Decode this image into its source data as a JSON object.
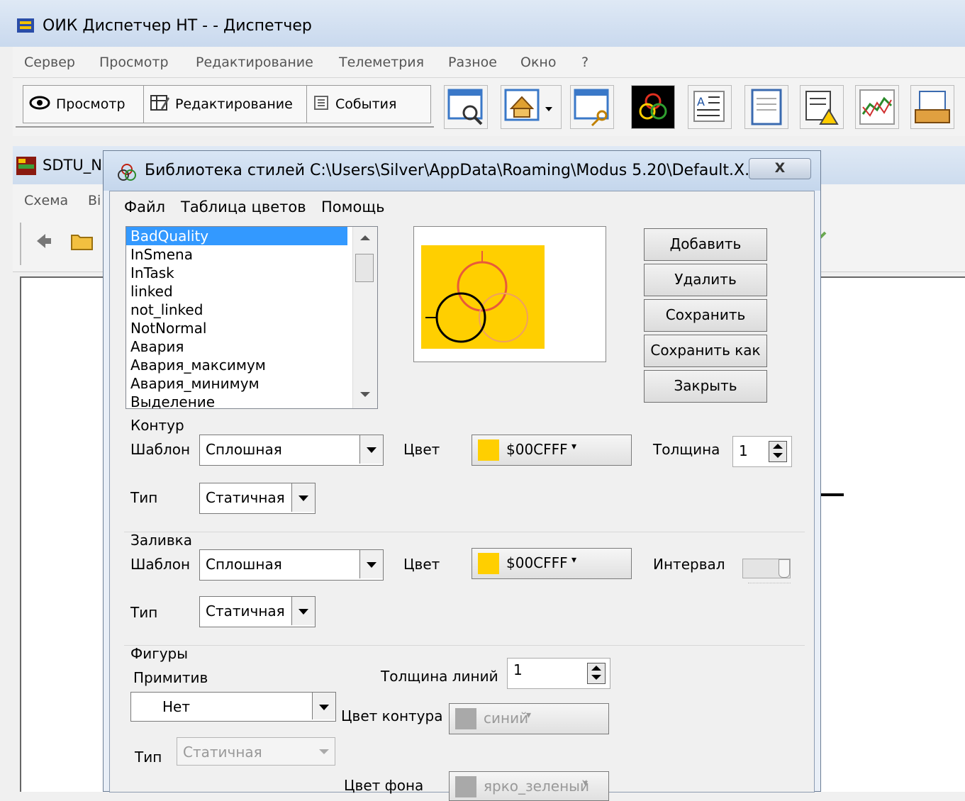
{
  "main_window": {
    "title": "ОИК Диспетчер НТ -  - Диспетчер",
    "menu": [
      "Сервер",
      "Просмотр",
      "Редактирование",
      "Телеметрия",
      "Разное",
      "Окно",
      "?"
    ],
    "toolbar_tabs": [
      "Просмотр",
      "Редактирование",
      "События"
    ],
    "toolbar_icons": [
      "search-window-icon",
      "home-icon",
      "key-window-icon",
      "style-library-icon",
      "text-format-icon",
      "notepad-icon",
      "warning-document-icon",
      "chart-icon",
      "tray-icon"
    ]
  },
  "child_window": {
    "title": "SDTU_N",
    "menu": [
      "Схема",
      "Ві"
    ]
  },
  "dialog": {
    "title": "Библиотека стилей C:\\Users\\Silver\\AppData\\Roaming\\Modus 5.20\\Default.X...",
    "close_label": "X",
    "menu": [
      "Файл",
      "Таблица цветов",
      "Помощь"
    ],
    "styles_list": [
      "BadQuality",
      "InSmena",
      "InTask",
      "linked",
      "not_linked",
      "NotNormal",
      "Авария",
      "Авария_максимум",
      "Авария_минимум",
      "Выделение"
    ],
    "selected_style": "BadQuality",
    "buttons": [
      "Добавить",
      "Удалить",
      "Сохранить",
      "Сохранить как",
      "Закрыть"
    ],
    "contour": {
      "group": "Контур",
      "template_label": "Шаблон",
      "template_value": "Сплошная",
      "color_label": "Цвет",
      "color_value": "$00CFFF",
      "thickness_label": "Толщина",
      "thickness_value": "1",
      "type_label": "Тип",
      "type_value": "Статичная"
    },
    "fill": {
      "group": "Заливка",
      "template_label": "Шаблон",
      "template_value": "Сплошная",
      "color_label": "Цвет",
      "color_value": "$00CFFF",
      "interval_label": "Интервал",
      "type_label": "Тип",
      "type_value": "Статичная"
    },
    "figures": {
      "group": "Фигуры",
      "primitive_label": "Примитив",
      "primitive_value": "Нет",
      "line_thickness_label": "Толщина линий",
      "line_thickness_value": "1",
      "contour_color_label": "Цвет контура",
      "contour_color_value": "синий",
      "type_label": "Тип",
      "type_value": "Статичная",
      "bg_color_label": "Цвет фона",
      "bg_color_value": "ярко_зеленый"
    },
    "swatch_color": "#ffcf00"
  }
}
